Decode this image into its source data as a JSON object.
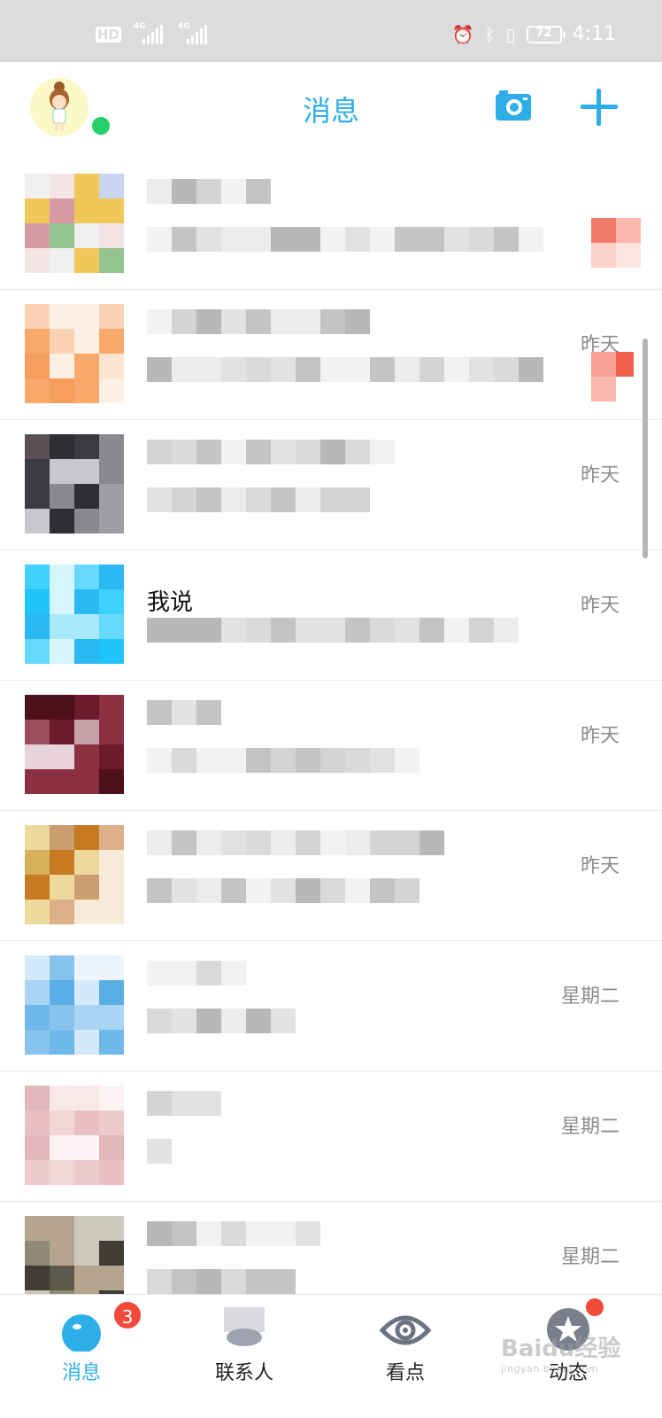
{
  "status_bar": {
    "hd_label": "HD",
    "net_label_1": "4G",
    "net_label_2": "4G",
    "battery_level": "72",
    "time": "4:11"
  },
  "header": {
    "title": "消息",
    "camera_icon": "camera-icon",
    "add_icon": "plus-icon"
  },
  "conversations": [
    {
      "time": "",
      "name_text": "",
      "has_unread": true
    },
    {
      "time": "昨天",
      "name_text": "",
      "has_unread": true
    },
    {
      "time": "昨天",
      "name_text": "",
      "has_unread": false
    },
    {
      "time": "昨天",
      "name_text": "我说",
      "has_unread": false
    },
    {
      "time": "昨天",
      "name_text": "",
      "has_unread": false
    },
    {
      "time": "昨天",
      "name_text": "",
      "has_unread": false
    },
    {
      "time": "星期二",
      "name_text": "",
      "has_unread": false
    },
    {
      "time": "星期二",
      "name_text": "",
      "has_unread": false
    },
    {
      "time": "星期二",
      "name_text": "",
      "has_unread": false
    }
  ],
  "bottom_nav": {
    "messages_label": "消息",
    "messages_badge": "3",
    "contacts_label": "联系人",
    "discover_label": "看点",
    "feed_label": "动态"
  },
  "watermark": {
    "main": "Baidu经验",
    "sub": "jingyan.baidu.com"
  },
  "colors": {
    "accent": "#2eaee8",
    "badge": "#f1493a",
    "online": "#25d06a",
    "status_bar_bg": "#dcdcdc"
  }
}
